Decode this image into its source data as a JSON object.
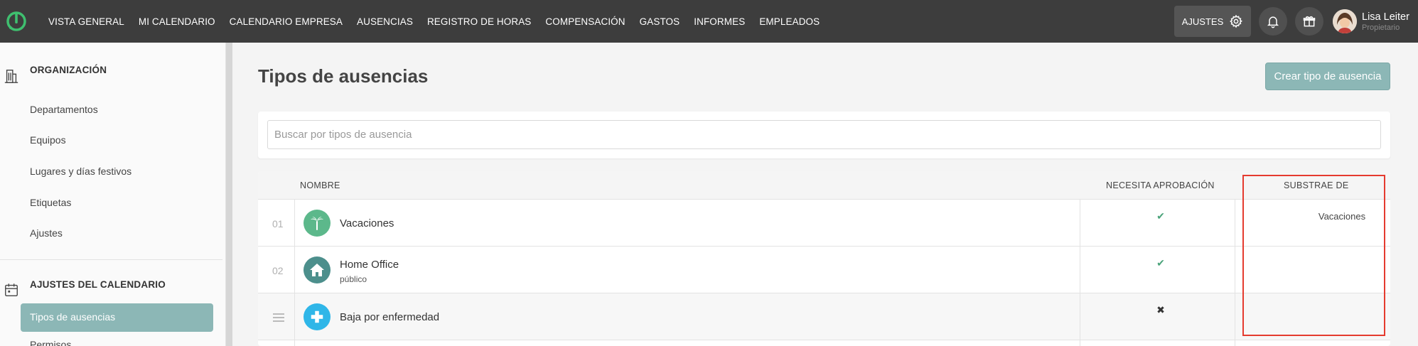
{
  "nav": {
    "items": [
      "VISTA GENERAL",
      "MI CALENDARIO",
      "CALENDARIO EMPRESA",
      "AUSENCIAS",
      "REGISTRO DE HORAS",
      "COMPENSACIÓN",
      "GASTOS",
      "INFORMES",
      "EMPLEADOS"
    ],
    "settings_label": "AJUSTES",
    "user": {
      "name": "Lisa Leiter",
      "role": "Propietario"
    }
  },
  "sidebar": {
    "sections": [
      {
        "title": "ORGANIZACIÓN",
        "icon": "building-icon",
        "items": [
          "Departamentos",
          "Equipos",
          "Lugares y días festivos",
          "Etiquetas",
          "Ajustes"
        ]
      },
      {
        "title": "AJUSTES DEL CALENDARIO",
        "icon": "calendar-icon",
        "items": [
          "Tipos de ausencias",
          "Permisos"
        ]
      }
    ],
    "active_item": "Tipos de ausencias",
    "partially_visible_item": "Permisos"
  },
  "main": {
    "title": "Tipos de ausencias",
    "create_button": "Crear tipo de ausencia",
    "search_placeholder": "Buscar por tipos de ausencia",
    "table": {
      "headers": {
        "name": "NOMBRE",
        "approval": "NECESITA APROBACIÓN",
        "subtract": "SUBSTRAE DE"
      },
      "rows": [
        {
          "index": "01",
          "name": "Vacaciones",
          "subtitle": "",
          "approval": "✔",
          "subtract_from": "Vacaciones",
          "icon": "palm-tree-icon",
          "icon_color": "#5cb88b"
        },
        {
          "index": "02",
          "name": "Home Office",
          "subtitle": "público",
          "approval": "✔",
          "subtract_from": "",
          "icon": "house-icon",
          "icon_color": "#4c8f8c"
        },
        {
          "index": "",
          "name": "Baja por enfermedad",
          "subtitle": "",
          "approval": "✖",
          "subtract_from": "",
          "icon": "medical-cross-icon",
          "icon_color": "#2fb6e8"
        }
      ]
    }
  },
  "colors": {
    "topbar": "#3d3d3d",
    "accent": "#8cb7b6",
    "check": "#4aa37a",
    "highlight": "#e53b2f"
  }
}
